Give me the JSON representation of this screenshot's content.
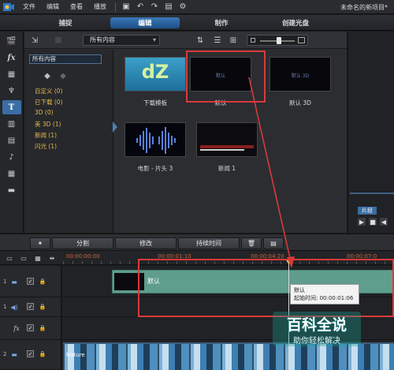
{
  "menu": {
    "items": [
      "文件",
      "编辑",
      "查看",
      "播放"
    ],
    "project_name": "未命名的新项目*"
  },
  "modes": {
    "tabs": [
      "捕捉",
      "编辑",
      "制作",
      "创建光盘"
    ],
    "active": "编辑"
  },
  "library": {
    "content_select": "所有内容",
    "category_all": "所有内容",
    "categories": [
      "自定义 (0)",
      "已下载 (0)",
      "3D (0)",
      "美 3D (1)",
      "新闻 (1)",
      "闪光 (1)"
    ],
    "thumbnails": [
      {
        "label": "下载模板",
        "logo_text": "dZ"
      },
      {
        "label": "默认",
        "preview_text": "默认"
      },
      {
        "label": "默认 3D",
        "preview_text": "默认 3D"
      },
      {
        "label": "电影 - 片头 3"
      },
      {
        "label": "新闻 1"
      }
    ]
  },
  "preview": {
    "segment_label": "片段"
  },
  "actions": {
    "split": "分割",
    "modify": "修改",
    "duration": "持续时间"
  },
  "timeline": {
    "ruler": [
      "00:00:00:00",
      "00:00:01:10",
      "00:00:04:20",
      "00:00:07:0"
    ],
    "tracks": [
      {
        "num": "1",
        "type": "video"
      },
      {
        "num": "1",
        "type": "audio"
      },
      {
        "num": "",
        "type": "fx"
      },
      {
        "num": "2",
        "type": "video"
      }
    ],
    "title_clip_name": "默认",
    "video_clip_name": "Nature",
    "tooltip": {
      "name": "默认",
      "start_time": "起始时间: 00:00:01:06"
    }
  },
  "watermark": {
    "title": "百科全说",
    "subtitle": "助你轻松解决"
  },
  "colors": {
    "accent": "#3b6ea3",
    "annotation": "#d83a3a",
    "title_clip": "#5f9d8d",
    "category_text": "#e6b74a",
    "ruler_text": "#c86a3c"
  }
}
